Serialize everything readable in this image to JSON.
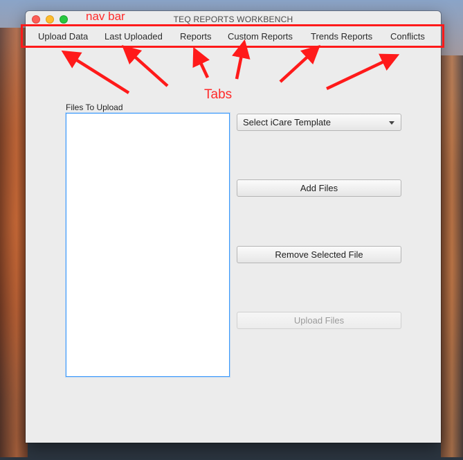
{
  "window": {
    "title": "TEQ REPORTS WORKBENCH"
  },
  "tabs": [
    {
      "label": "Upload Data"
    },
    {
      "label": "Last Uploaded"
    },
    {
      "label": "Reports"
    },
    {
      "label": "Custom Reports"
    },
    {
      "label": "Trends Reports"
    },
    {
      "label": "Conflicts"
    }
  ],
  "upload": {
    "files_label": "Files To Upload",
    "template_select": "Select iCare Template",
    "add_label": "Add Files",
    "remove_label": "Remove Selected File",
    "upload_label": "Upload Files",
    "upload_enabled": false
  },
  "annotations": {
    "nav_bar": "nav bar",
    "tabs": "Tabs",
    "color": "#ff2a2a"
  },
  "icons": {
    "select_arrow": "chevron-down-icon"
  }
}
